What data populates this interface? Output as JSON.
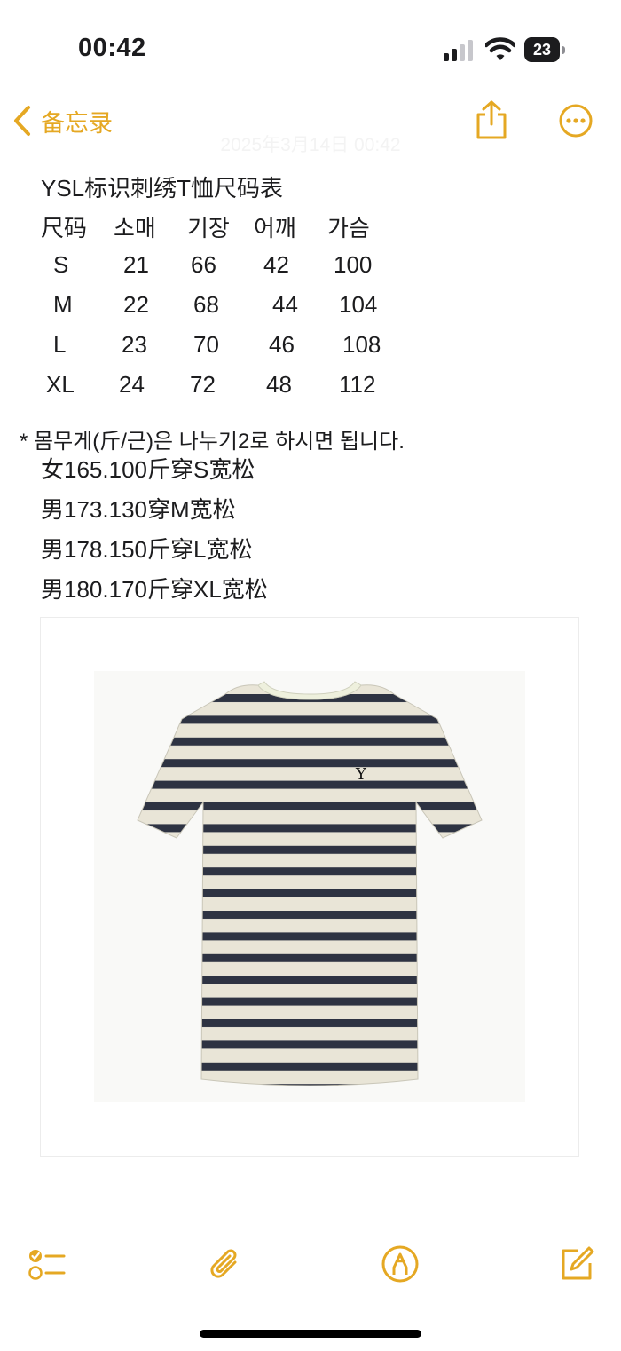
{
  "status_bar": {
    "time": "00:42",
    "battery": "23"
  },
  "nav": {
    "back_label": "备忘录",
    "date_faint": "2025年3月14日 00:42"
  },
  "note": {
    "title": "YSL标识刺绣T恤尺码表",
    "size_table": {
      "headers": [
        "尺码",
        "소매",
        "기장",
        "어깨",
        "가슴"
      ],
      "rows": [
        [
          "S",
          "21",
          "66",
          "42",
          "100"
        ],
        [
          "M",
          "22",
          "68",
          "44",
          "104"
        ],
        [
          "L",
          "23",
          "70",
          "46",
          "108"
        ],
        [
          "XL",
          "24",
          "72",
          "48",
          "112"
        ]
      ]
    },
    "weight_note": "* 몸무게(斤/근)은 나누기2로 하시면 됩니다.",
    "recommendations": [
      "女165.100斤穿S宽松",
      "男173.130穿M宽松",
      "男178.150斤穿L宽松",
      "男180.170斤穿XL宽松"
    ],
    "image": {
      "subject": "striped t-shirt",
      "stripe_color": "#2e3342",
      "base_color": "#e9e5d7",
      "collar_color": "#eef0dd"
    }
  },
  "toolbar": {
    "icons": [
      "checklist-icon",
      "paperclip-icon",
      "markup-pen-icon",
      "compose-icon"
    ]
  },
  "colors": {
    "accent": "#e5a823"
  }
}
